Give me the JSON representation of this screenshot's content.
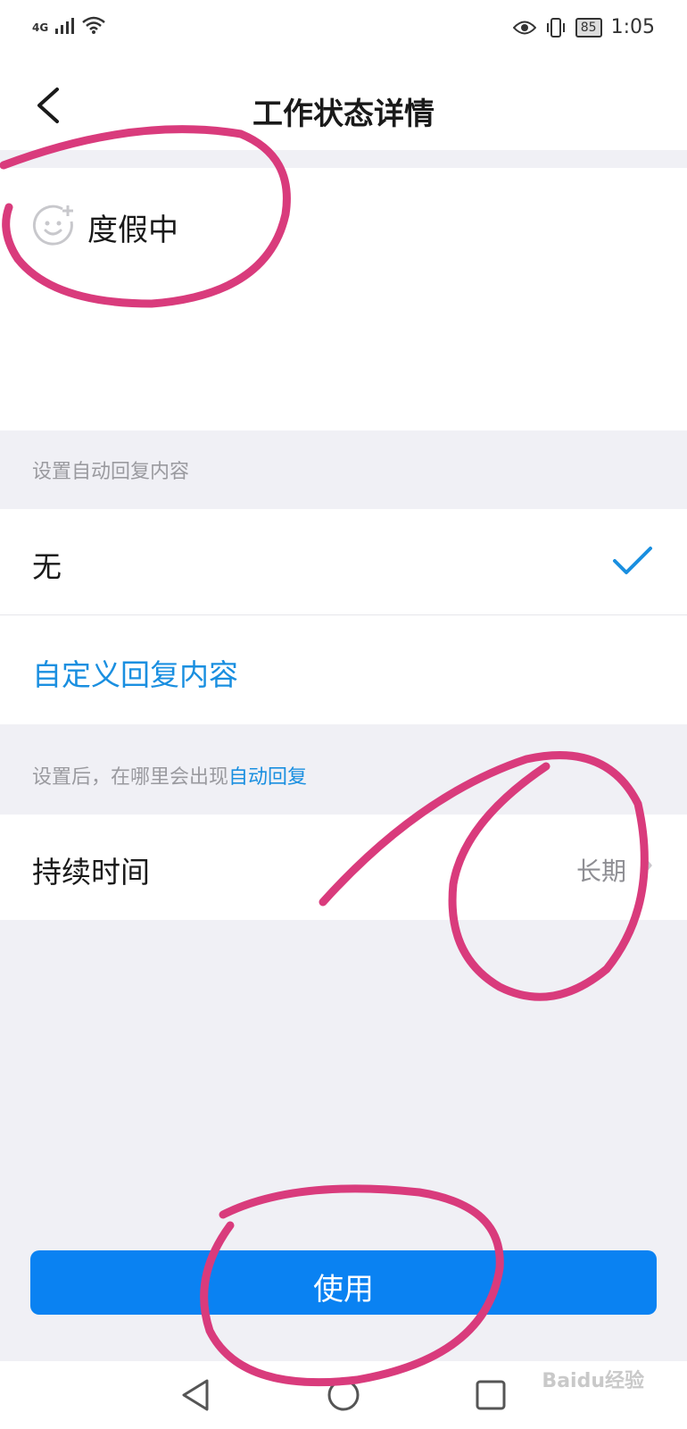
{
  "status_bar": {
    "network": "4G",
    "battery": "85",
    "time": "1:05"
  },
  "header": {
    "title": "工作状态详情"
  },
  "current_status": {
    "label": "度假中"
  },
  "auto_reply": {
    "section_label": "设置自动回复内容",
    "selected_option": "无",
    "custom_option": "自定义回复内容"
  },
  "hint": {
    "prefix": "设置后，在哪里会出现",
    "link": "自动回复"
  },
  "duration": {
    "label": "持续时间",
    "value": "长期"
  },
  "use_button": {
    "label": "使用"
  },
  "watermark": "Baidu经验",
  "colors": {
    "accent": "#1a8fe0",
    "button": "#0a82f2",
    "annotation": "#d93b7c"
  }
}
